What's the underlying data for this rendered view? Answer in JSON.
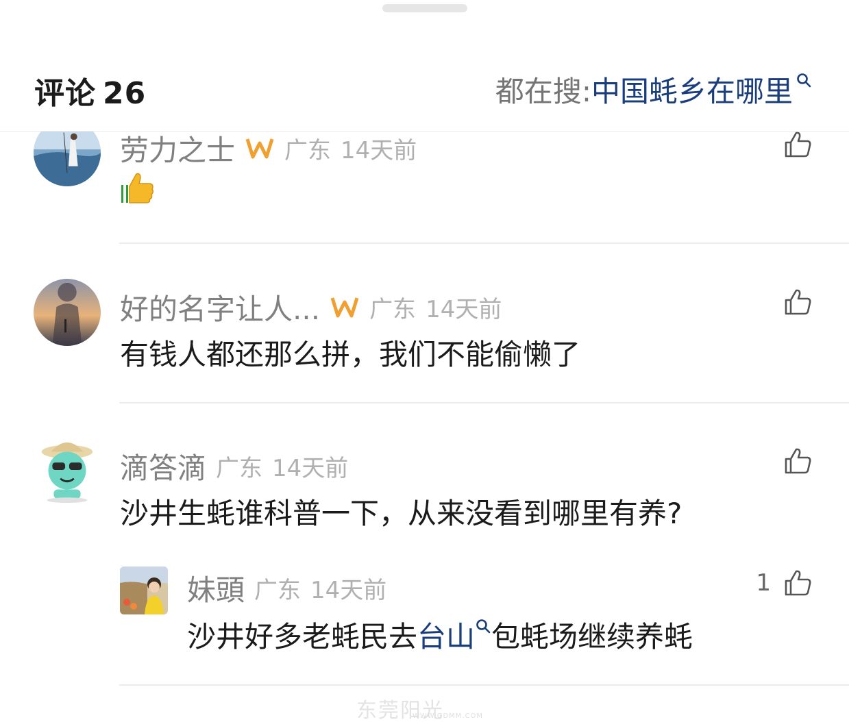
{
  "header": {
    "title": "评论",
    "count": "26",
    "hot_search_prefix": "都在搜:",
    "hot_search_query": "中国蚝乡在哪里"
  },
  "comments": [
    {
      "username": "劳力之士",
      "location": "广东",
      "time": "14天前",
      "text": "👍",
      "badge": "vip-badge-icon"
    },
    {
      "username": "好的名字让人...",
      "location": "广东",
      "time": "14天前",
      "text": "有钱人都还那么拼，我们不能偷懒了",
      "badge": "vip-badge-icon"
    },
    {
      "username": "滴答滴",
      "location": "广东",
      "time": "14天前",
      "text": "沙井生蚝谁科普一下，从来没看到哪里有养?"
    }
  ],
  "reply": {
    "username": "妹頭",
    "location": "广东",
    "time": "14天前",
    "likes": "1",
    "text_before": "沙井好多老蚝民去",
    "link": "台山",
    "text_after": "包蚝场继续养蚝"
  },
  "watermark": {
    "logo": "东莞阳光",
    "url": "WWW.GDMM.COM"
  },
  "colors": {
    "link": "#1a3d7c",
    "username": "#808080",
    "meta": "#b0b0b0",
    "badge": "#f0a030"
  }
}
